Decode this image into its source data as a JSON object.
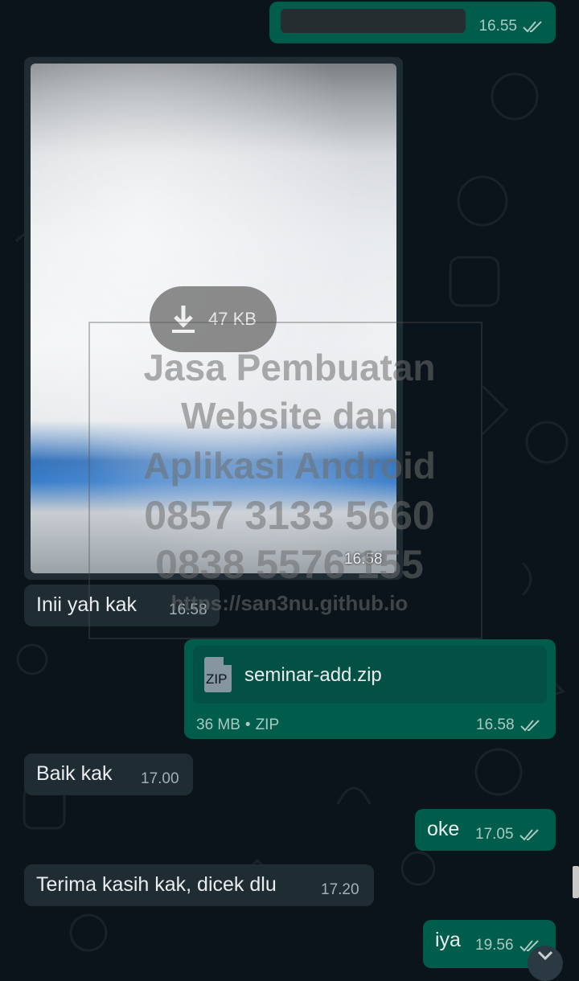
{
  "colors": {
    "background": "#0b141a",
    "incoming_bubble": "#202c33",
    "outgoing_bubble": "#005c4b",
    "tick_color": "#a9c9c1"
  },
  "messages": {
    "m1": {
      "time": "16.55",
      "status_icon": "double-check-icon"
    },
    "image": {
      "size": "47 KB",
      "time": "16.58",
      "download_icon": "download-arrow-icon"
    },
    "m2": {
      "text": "Inii yah kak",
      "time": "16.58"
    },
    "file": {
      "file_icon": "zip-file-icon",
      "file_icon_label": "ZIP",
      "name": "seminar-add.zip",
      "size": "36 MB",
      "separator": "•",
      "type": "ZIP",
      "time": "16.58",
      "status_icon": "double-check-icon"
    },
    "m3": {
      "text": "Baik kak",
      "time": "17.00"
    },
    "m4": {
      "text": "oke",
      "time": "17.05",
      "status_icon": "double-check-icon"
    },
    "m5": {
      "text": "Terima kasih kak, dicek dlu",
      "time": "17.20"
    },
    "m6": {
      "text": "iya",
      "time": "19.56",
      "status_icon": "double-check-icon"
    }
  },
  "watermark": {
    "line1": "Jasa Pembuatan",
    "line2": "Website dan",
    "line3": "Aplikasi Android",
    "line4": "0857 3133 5660",
    "line5": "0838 5576 155",
    "line6": "https://san3nu.github.io"
  },
  "scroll_button_icon": "chevron-down-icon"
}
